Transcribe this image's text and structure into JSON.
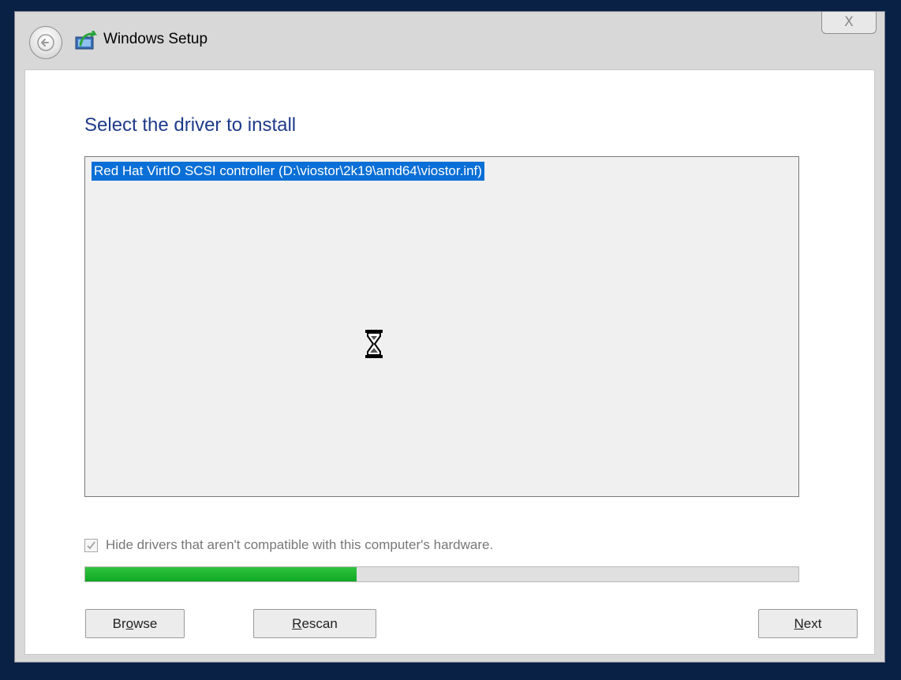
{
  "window": {
    "title": "Windows Setup",
    "close_label": "X"
  },
  "main": {
    "heading": "Select the driver to install",
    "drivers": [
      {
        "label": "Red Hat VirtIO SCSI controller (D:\\viostor\\2k19\\amd64\\viostor.inf)",
        "selected": true
      }
    ],
    "hide_incompatible": {
      "checked": true,
      "label": "Hide drivers that aren't compatible with this computer's hardware."
    },
    "progress_fraction": 0.38
  },
  "buttons": {
    "browse": {
      "pre": "Br",
      "mnemonic": "o",
      "post": "wse"
    },
    "rescan": {
      "pre": "",
      "mnemonic": "R",
      "post": "escan"
    },
    "next": {
      "pre": "",
      "mnemonic": "N",
      "post": "ext"
    }
  },
  "icons": {
    "back": "back-arrow-icon",
    "app": "windows-setup-icon",
    "cursor": "hourglass-icon"
  },
  "colors": {
    "heading": "#1e3a8a",
    "selection": "#0a6fd6",
    "progress": "#10a824"
  }
}
